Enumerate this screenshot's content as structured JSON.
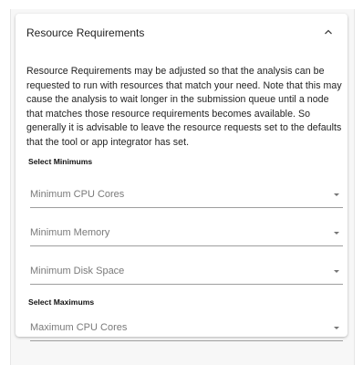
{
  "panel": {
    "title": "Resource Requirements",
    "description": "Resource Requirements may be adjusted so that the analysis can be requested to run with resources that match your need. Note that this may cause the analysis to wait longer in the submission queue until a node that matches those resource requirements becomes available. So generally it is advisable to leave the resource requests set to the defaults that the tool or app integrator has set.",
    "expanded": true
  },
  "minimums": {
    "label": "Select Minimums",
    "fields": [
      {
        "label": "Minimum CPU Cores"
      },
      {
        "label": "Minimum Memory"
      },
      {
        "label": "Minimum Disk Space"
      }
    ]
  },
  "maximums": {
    "label": "Select Maximums",
    "fields": [
      {
        "label": "Maximum CPU Cores"
      }
    ]
  },
  "icons": {
    "collapse": "chevron-up-icon",
    "dropdown": "caret-down-icon"
  }
}
